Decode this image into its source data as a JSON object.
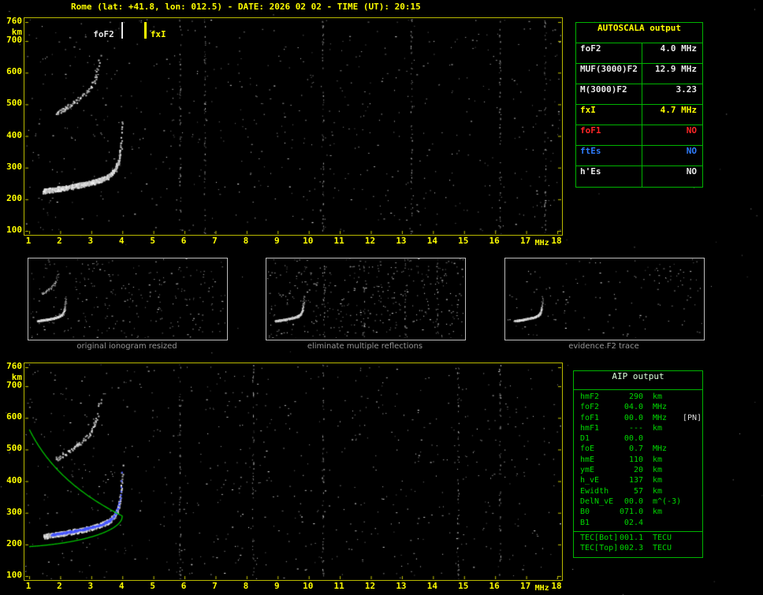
{
  "header": {
    "title": "Rome (lat: +41.8, lon: 012.5) - DATE: 2026 02 02 - TIME (UT): 20:15"
  },
  "colors": {
    "axis_yellow": "#ffff00",
    "table_green": "#00b400",
    "text_green": "#00d800",
    "alert_red": "#ff2626",
    "info_blue": "#2f7dff",
    "trace_white": "#e8e8e8",
    "profile_green": "#00c400",
    "restored_trace_blue": "#4656ff",
    "caption_gray": "#969696"
  },
  "top_ionogram": {
    "y_axis_unit": "km",
    "x_axis_unit": "MHz",
    "y_ticks": [
      "760",
      "700",
      "600",
      "500",
      "400",
      "300",
      "200",
      "100"
    ],
    "x_ticks": [
      "1",
      "2",
      "3",
      "4",
      "5",
      "6",
      "7",
      "8",
      "9",
      "10",
      "11",
      "12",
      "13",
      "14",
      "15",
      "16",
      "17",
      "18"
    ],
    "markers": {
      "foF2_label": "foF2",
      "fxI_label": "fxI",
      "foF2_mhz": 4.0,
      "fxI_mhz": 4.7
    }
  },
  "bottom_ionogram": {
    "y_axis_unit": "km",
    "x_axis_unit": "MHz",
    "y_ticks": [
      "760",
      "700",
      "600",
      "500",
      "400",
      "300",
      "200",
      "100"
    ],
    "x_ticks": [
      "1",
      "2",
      "3",
      "4",
      "5",
      "6",
      "7",
      "8",
      "9",
      "10",
      "11",
      "12",
      "13",
      "14",
      "15",
      "16",
      "17",
      "18"
    ]
  },
  "autoscala_table": {
    "title": "AUTOSCALA output",
    "rows": [
      {
        "label": "foF2",
        "value": "4.0 MHz",
        "color": "white"
      },
      {
        "label": "MUF(3000)F2",
        "value": "12.9 MHz",
        "color": "white"
      },
      {
        "label": "M(3000)F2",
        "value": "3.23",
        "color": "white"
      },
      {
        "label": "fxI",
        "value": "4.7 MHz",
        "color": "yellow"
      },
      {
        "label": "foF1",
        "value": "NO",
        "color": "red"
      },
      {
        "label": "ftEs",
        "value": "NO",
        "color": "blue"
      },
      {
        "label": "h'Es",
        "value": "NO",
        "color": "white"
      }
    ]
  },
  "thumbnails": [
    {
      "caption": "original ionogram resized"
    },
    {
      "caption": "eliminate multiple reflections"
    },
    {
      "caption": "evidence F2 trace"
    }
  ],
  "aip_table": {
    "title": "AIP output",
    "rows": [
      {
        "label": "hmF2",
        "value": "290",
        "unit": "km",
        "note": ""
      },
      {
        "label": "foF2",
        "value": "04.0",
        "unit": "MHz",
        "note": ""
      },
      {
        "label": "foF1",
        "value": "00.0",
        "unit": "MHz",
        "note": "[PN]"
      },
      {
        "label": "hmF1",
        "value": "---",
        "unit": "km",
        "note": ""
      },
      {
        "label": "D1",
        "value": "00.0",
        "unit": "",
        "note": ""
      },
      {
        "label": "foE",
        "value": "0.7",
        "unit": "MHz",
        "note": ""
      },
      {
        "label": "hmE",
        "value": "110",
        "unit": "km",
        "note": ""
      },
      {
        "label": "ymE",
        "value": "20",
        "unit": "km",
        "note": ""
      },
      {
        "label": "h_vE",
        "value": "137",
        "unit": "km",
        "note": ""
      },
      {
        "label": "Ewidth",
        "value": "57",
        "unit": "km",
        "note": ""
      },
      {
        "label": "DelN_vE",
        "value": "00.0",
        "unit": "m^(-3)",
        "note": ""
      },
      {
        "label": "B0",
        "value": "071.0",
        "unit": "km",
        "note": ""
      },
      {
        "label": "B1",
        "value": "02.4",
        "unit": "",
        "note": ""
      }
    ],
    "tec_rows": [
      {
        "label": "TEC[Bot]",
        "value": "001.1",
        "unit": "TECU"
      },
      {
        "label": "TEC[Top]",
        "value": "002.3",
        "unit": "TECU"
      }
    ]
  },
  "chart_data": {
    "type": "scatter",
    "panels": [
      {
        "name": "scaled ionogram",
        "xlabel": "MHz",
        "ylabel": "km",
        "xlim": [
          1,
          18
        ],
        "ylim": [
          100,
          760
        ],
        "f2_trace": {
          "x_mhz": [
            1.5,
            2.0,
            2.5,
            3.0,
            3.3,
            3.6,
            3.8,
            3.9,
            3.95,
            4.0
          ],
          "virtual_height_km": [
            228,
            236,
            246,
            258,
            268,
            285,
            305,
            330,
            375,
            430
          ]
        },
        "second_hop_trace": {
          "x_mhz": [
            1.9,
            2.2,
            2.6,
            3.0,
            3.2,
            3.3
          ],
          "virtual_height_km": [
            472,
            490,
            520,
            560,
            610,
            680
          ]
        },
        "markers": {
          "foF2_mhz": 4.0,
          "fxI_mhz": 4.7
        }
      },
      {
        "name": "inverted electron density profile",
        "xlabel": "MHz",
        "ylabel": "km",
        "xlim": [
          1,
          18
        ],
        "ylim": [
          100,
          760
        ],
        "profile_peak": {
          "foF2_mhz": 4.0,
          "hmF2_km": 290
        },
        "profile_description": "green bottomside layer rising from ~195 km at 1 MHz to peak 290 km at 4 MHz, topside decaying to ~570 km at 1 MHz",
        "restored_trace_color": "blue"
      }
    ]
  }
}
